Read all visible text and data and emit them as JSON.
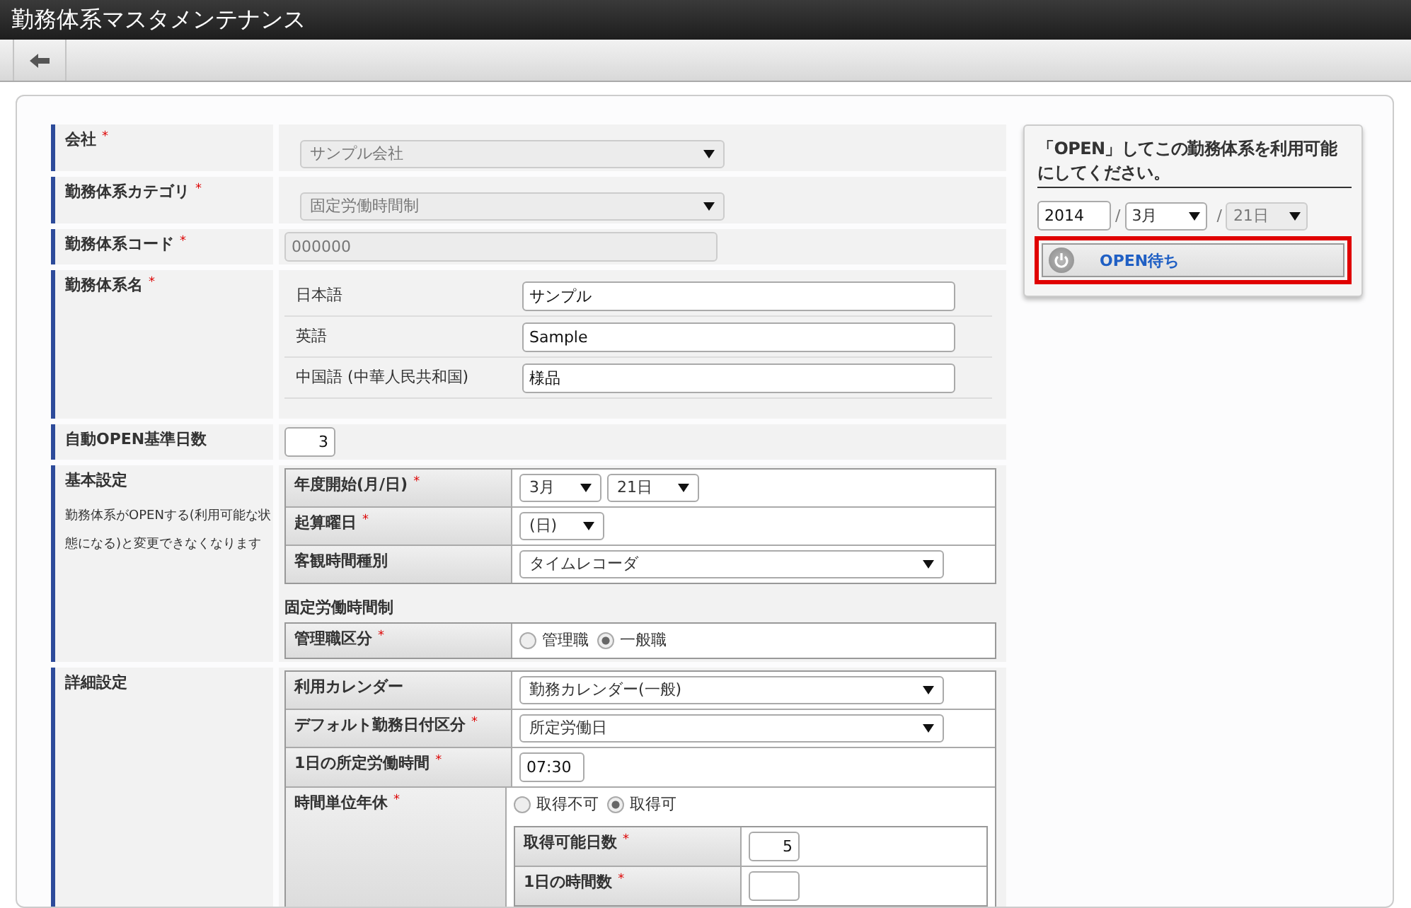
{
  "window": {
    "title": "勤務体系マスタメンテナンス"
  },
  "form": {
    "required_mark": "*",
    "rows": [
      {
        "kind": "select",
        "label": "会社",
        "required": true,
        "value": "サンプル会社",
        "disabled": true
      },
      {
        "kind": "select",
        "label": "勤務体系カテゴリ",
        "required": true,
        "value": "固定労働時間制",
        "disabled": true
      },
      {
        "kind": "text",
        "label": "勤務体系コード",
        "required": true,
        "value": "000000",
        "disabled": true
      },
      {
        "kind": "names",
        "label": "勤務体系名",
        "required": true,
        "names": [
          {
            "language": "日本語",
            "value": "サンプル"
          },
          {
            "language": "英語",
            "value": "Sample"
          },
          {
            "language": "中国語 (中華人民共和国)",
            "value": "様品"
          }
        ]
      },
      {
        "kind": "number",
        "label": "自動OPEN基準日数",
        "required": false,
        "value": "3"
      },
      {
        "kind": "section",
        "label": "基本設定",
        "note": "勤務体系がOPENする(利用可能な状態になる)と変更できなくなります",
        "groups": [
          {
            "fields": [
              {
                "kind": "selects",
                "label": "年度開始(月/日)",
                "required": true,
                "values": [
                  "3月",
                  "21日"
                ]
              },
              {
                "kind": "selects",
                "label": "起算曜日",
                "required": true,
                "values": [
                  "(日)"
                ]
              },
              {
                "kind": "select",
                "label": "客観時間種別",
                "required": false,
                "value": "タイムレコーダ"
              }
            ]
          },
          {
            "heading": "固定労働時間制",
            "fields": [
              {
                "kind": "radio",
                "label": "管理職区分",
                "required": true,
                "options": [
                  {
                    "label": "管理職",
                    "selected": false
                  },
                  {
                    "label": "一般職",
                    "selected": true
                  }
                ]
              }
            ]
          }
        ]
      },
      {
        "kind": "section",
        "label": "詳細設定",
        "groups": [
          {
            "fields": [
              {
                "kind": "select",
                "label": "利用カレンダー",
                "required": false,
                "value": "勤務カレンダー(一般)"
              },
              {
                "kind": "select",
                "label": "デフォルト勤務日付区分",
                "required": true,
                "value": "所定労働日"
              },
              {
                "kind": "time",
                "label": "1日の所定労働時間",
                "required": true,
                "value": "07:30"
              },
              {
                "kind": "radio",
                "label": "時間単位年休",
                "required": true,
                "options": [
                  {
                    "label": "取得不可",
                    "selected": false
                  },
                  {
                    "label": "取得可",
                    "selected": true
                  }
                ],
                "subfields": [
                  {
                    "kind": "number",
                    "label": "取得可能日数",
                    "required": true,
                    "value": "5"
                  },
                  {
                    "kind": "number",
                    "label": "1日の時間数",
                    "required": true
                  }
                ]
              }
            ]
          }
        ]
      }
    ]
  },
  "open_panel": {
    "message": "「OPEN」してこの勤務体系を利用可能にしてください。",
    "date_parts": [
      {
        "kind": "input",
        "value": "2014"
      },
      {
        "kind": "separator",
        "value": "/"
      },
      {
        "kind": "select",
        "value": "3月",
        "disabled": false
      },
      {
        "kind": "separator",
        "value": "/"
      },
      {
        "kind": "select",
        "value": "21日",
        "disabled": true
      }
    ],
    "button": {
      "label": "OPEN待ち",
      "highlighted": true
    }
  }
}
